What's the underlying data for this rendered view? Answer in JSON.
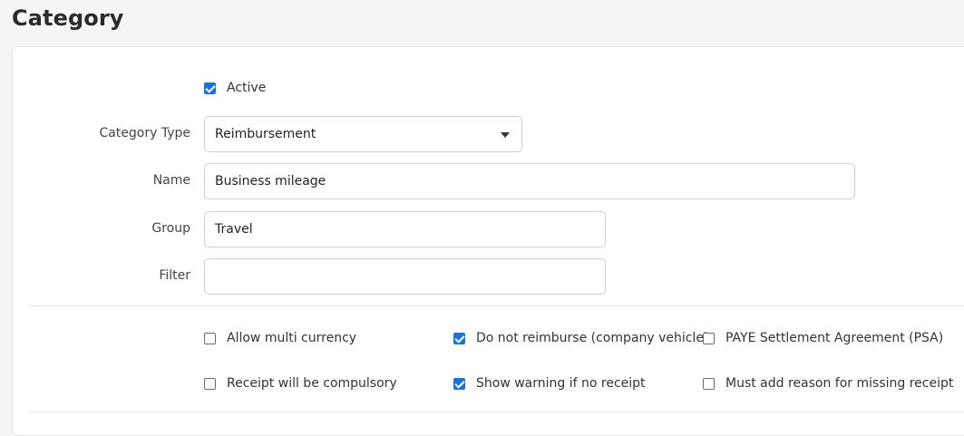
{
  "page": {
    "title": "Category"
  },
  "form": {
    "active": {
      "label": "Active",
      "checked": true
    },
    "category_type": {
      "label": "Category Type",
      "value": "Reimbursement"
    },
    "name": {
      "label": "Name",
      "value": "Business mileage"
    },
    "group": {
      "label": "Group",
      "value": "Travel"
    },
    "filter": {
      "label": "Filter",
      "value": ""
    }
  },
  "options": [
    {
      "label": "Allow multi currency",
      "checked": false
    },
    {
      "label": "Do not reimburse (company vehicle)",
      "checked": true
    },
    {
      "label": "PAYE Settlement Agreement (PSA)",
      "checked": false
    },
    {
      "label": "Receipt will be compulsory",
      "checked": false
    },
    {
      "label": "Show warning if no receipt",
      "checked": true
    },
    {
      "label": "Must add reason for missing receipt",
      "checked": false
    }
  ],
  "colors": {
    "accent": "#1673e6",
    "background": "#f5f5f8",
    "card": "#ffffff"
  }
}
